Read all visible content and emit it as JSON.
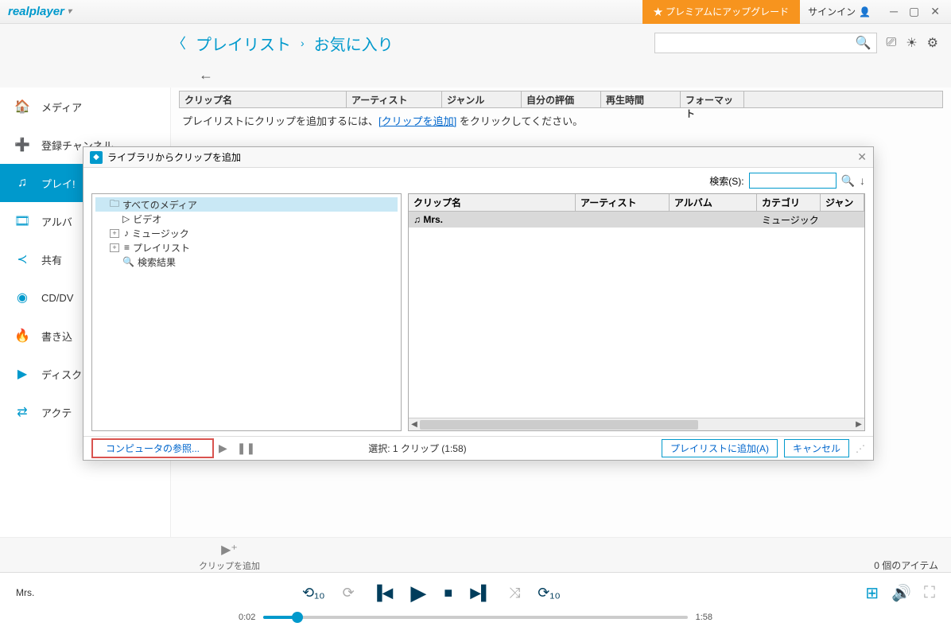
{
  "titlebar": {
    "logo": "realplayer",
    "premium": "★ プレミアムにアップグレード",
    "signin": "サインイン"
  },
  "breadcrumb": {
    "item1": "プレイリスト",
    "item2": "お気に入り"
  },
  "sidebar": {
    "items": [
      {
        "icon": "🏠",
        "label": "メディア"
      },
      {
        "icon": "➕",
        "label": "登録チャンネル"
      },
      {
        "icon": "♫",
        "label": "プレイ!"
      },
      {
        "icon": "🎞",
        "label": "アルバ"
      },
      {
        "icon": "<",
        "label": "共有"
      },
      {
        "icon": "◉",
        "label": "CD/DV"
      },
      {
        "icon": "🔥",
        "label": "書き込"
      },
      {
        "icon": "▶",
        "label": "ディスク"
      },
      {
        "icon": "⇄",
        "label": "アクテ"
      }
    ]
  },
  "table": {
    "headers": {
      "clip": "クリップ名",
      "artist": "アーティスト",
      "genre": "ジャンル",
      "rating": "自分の評価",
      "duration": "再生時間",
      "format": "フォーマット"
    },
    "hint_pre": "プレイリストにクリップを追加するには、",
    "hint_link": "[クリップを追加]",
    "hint_post": " をクリックしてください。"
  },
  "dialog": {
    "title": "ライブラリからクリップを追加",
    "search_label": "検索(S):",
    "tree": {
      "all": "すべてのメディア",
      "video": "ビデオ",
      "music": "ミュージック",
      "playlist": "プレイリスト",
      "results": "検索結果"
    },
    "list": {
      "headers": {
        "clip": "クリップ名",
        "artist": "アーティスト",
        "album": "アルバム",
        "category": "カテゴリ",
        "genre": "ジャン"
      },
      "row": {
        "name": "Mrs.",
        "category": "ミュージック"
      }
    },
    "browse": "コンピュータの参照...",
    "selection": "選択: 1 クリップ (1:58)",
    "add_btn": "プレイリストに追加(A)",
    "cancel_btn": "キャンセル"
  },
  "toolbar2": {
    "addclip": "クリップを追加",
    "itemcount": "0 個のアイテム"
  },
  "player": {
    "now_playing": "Mrs.",
    "time_current": "0:02",
    "time_total": "1:58"
  }
}
